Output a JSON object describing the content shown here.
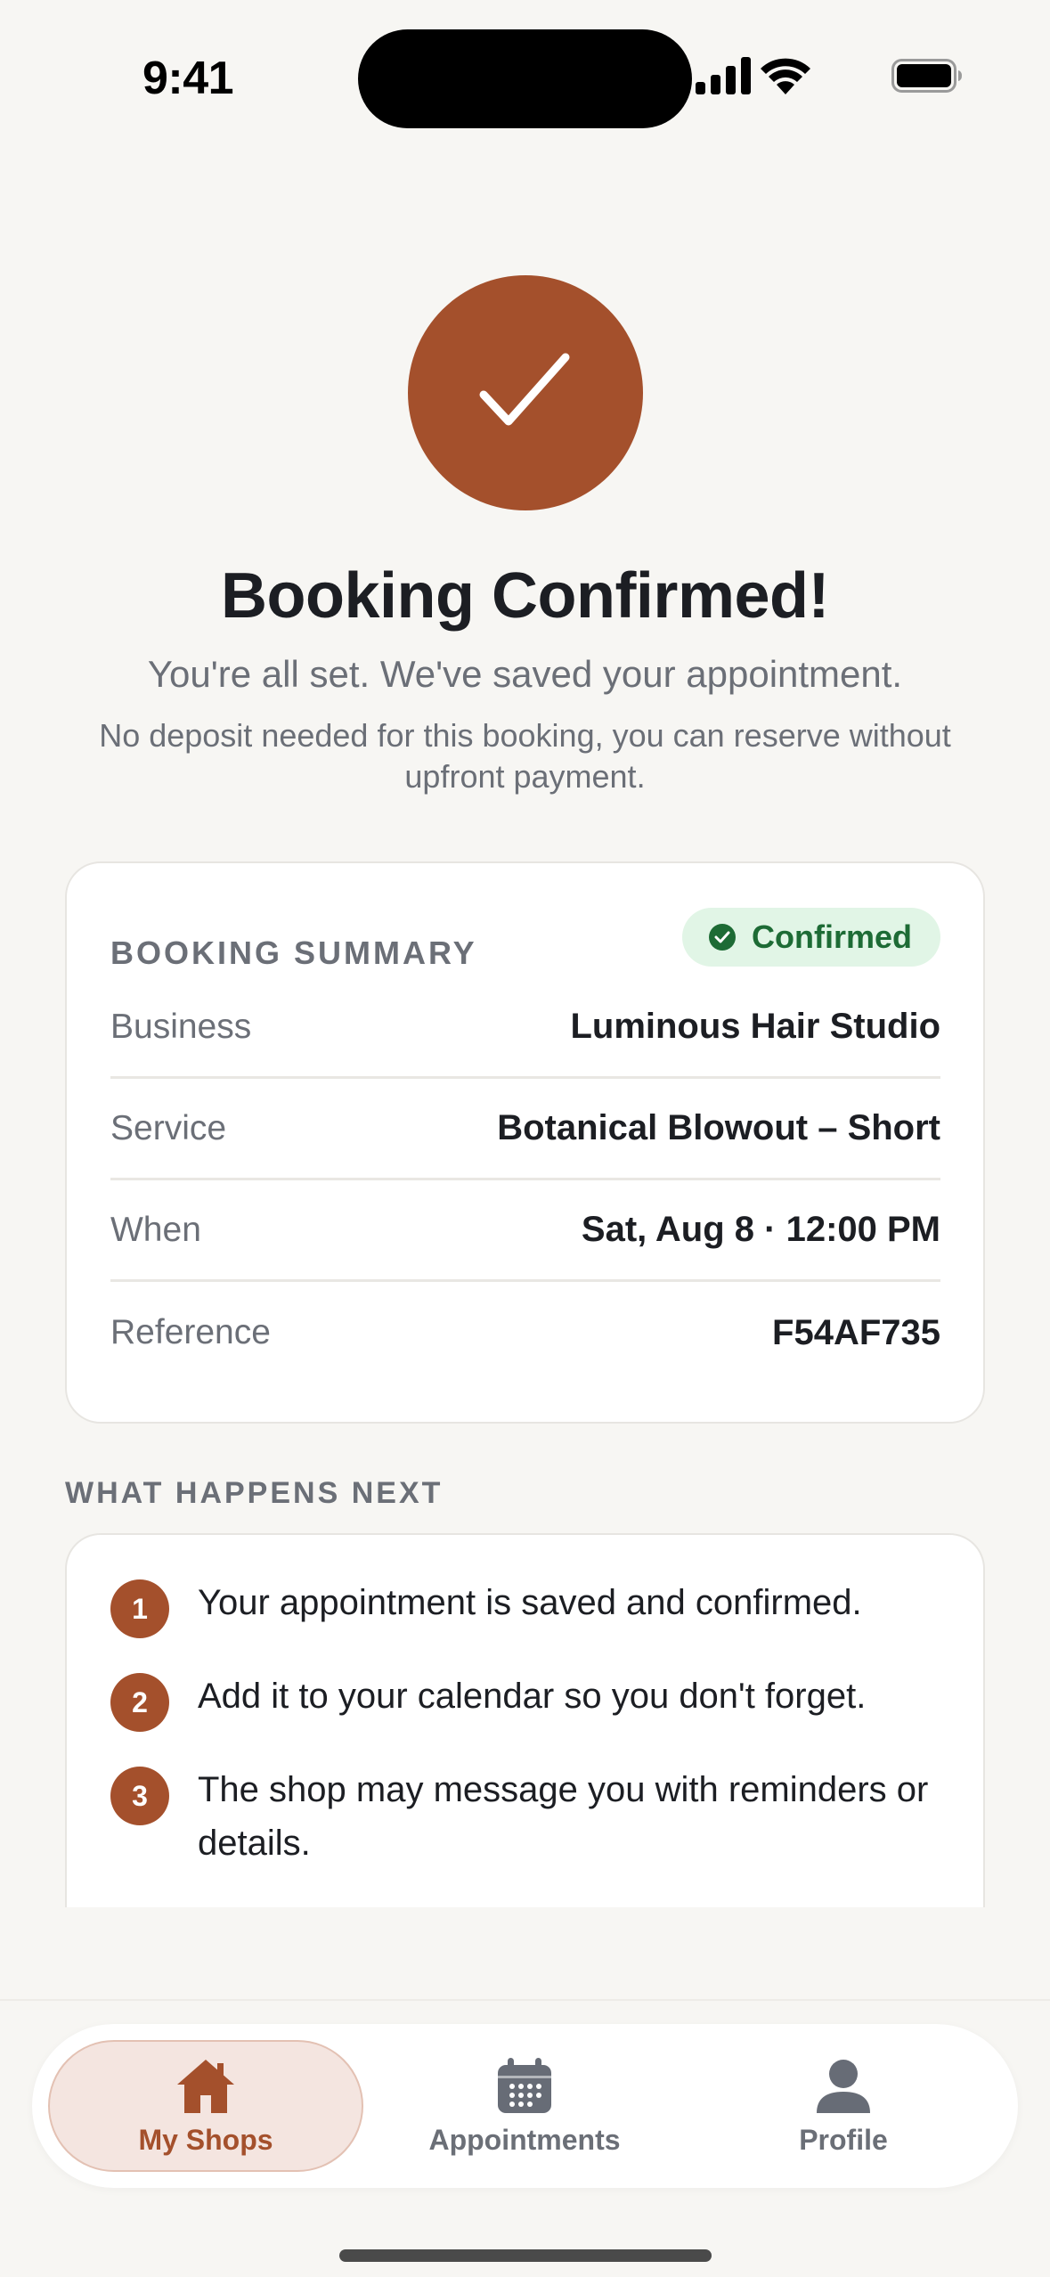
{
  "status_bar": {
    "time": "9:41"
  },
  "hero": {
    "title": "Booking Confirmed!",
    "subtitle": "You're all set. We've saved your appointment.",
    "note": "No deposit needed for this booking, you can reserve without upfront payment."
  },
  "summary": {
    "heading": "BOOKING SUMMARY",
    "badge": "Confirmed",
    "rows": [
      {
        "label": "Business",
        "value": "Luminous Hair Studio"
      },
      {
        "label": "Service",
        "value": "Botanical Blowout – Short"
      },
      {
        "label": "When",
        "value": "Sat, Aug 8 · 12:00 PM"
      },
      {
        "label": "Reference",
        "value": "F54AF735"
      }
    ]
  },
  "next": {
    "heading": "WHAT HAPPENS NEXT",
    "steps": [
      {
        "num": "1",
        "text": "Your appointment is saved and confirmed."
      },
      {
        "num": "2",
        "text": "Add it to your calendar so you don't forget."
      },
      {
        "num": "3",
        "text": "The shop may message you with reminders or details."
      }
    ]
  },
  "tabs": [
    {
      "label": "My Shops",
      "icon": "house-icon",
      "active": true
    },
    {
      "label": "Appointments",
      "icon": "calendar-icon",
      "active": false
    },
    {
      "label": "Profile",
      "icon": "person-icon",
      "active": false
    }
  ],
  "colors": {
    "accent": "#a4502c",
    "success_bg": "#e1f5e6",
    "success_text": "#1d6b35",
    "background": "#f7f6f3"
  }
}
